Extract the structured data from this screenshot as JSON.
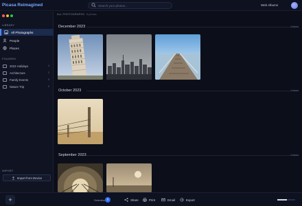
{
  "header": {
    "app_title": "Picasa Reimagined",
    "search_placeholder": "Search your photos...",
    "web_albums": "Web Albums"
  },
  "sidebar": {
    "library_label": "LIBRARY",
    "library_items": [
      {
        "label": "All Photographs",
        "icon": "photos-icon",
        "active": true
      },
      {
        "label": "People",
        "icon": "people-icon",
        "active": false
      },
      {
        "label": "Places",
        "icon": "globe-icon",
        "active": false
      }
    ],
    "folders_label": "FOLDERS",
    "folders": [
      {
        "label": "2023 Holidays",
        "count": "4"
      },
      {
        "label": "Architecture",
        "count": "2"
      },
      {
        "label": "Family Events",
        "count": "0"
      },
      {
        "label": "Nature Trip",
        "count": "0"
      }
    ],
    "import_label": "IMPORT",
    "import_button": "Import from Device"
  },
  "main": {
    "breadcrumb": "ALL PHOTOGRAPHS",
    "breadcrumb_sub": "6 photos",
    "sections": [
      {
        "title": "December 2023",
        "count": "3 items",
        "photos": [
          "leaning-tower",
          "city-skyline",
          "pier"
        ]
      },
      {
        "title": "October 2023",
        "count": "1 items",
        "photos": [
          "fence-post"
        ]
      },
      {
        "title": "September 2023",
        "count": "2 items",
        "photos": [
          "tunnel",
          "field-sunset"
        ]
      }
    ]
  },
  "bottom": {
    "add_label": "+",
    "selection_label": "Selection",
    "selection_count": "0",
    "actions": [
      {
        "label": "Share",
        "icon": "share-icon"
      },
      {
        "label": "Print",
        "icon": "print-icon"
      },
      {
        "label": "Email",
        "icon": "email-icon"
      },
      {
        "label": "Export",
        "icon": "export-icon"
      }
    ],
    "zoom_level": 0.55
  },
  "colors": {
    "accent": "#4d86ff",
    "background": "#0c0f1a",
    "sidebar": "#0f1322",
    "title": "#7aa7ff"
  }
}
